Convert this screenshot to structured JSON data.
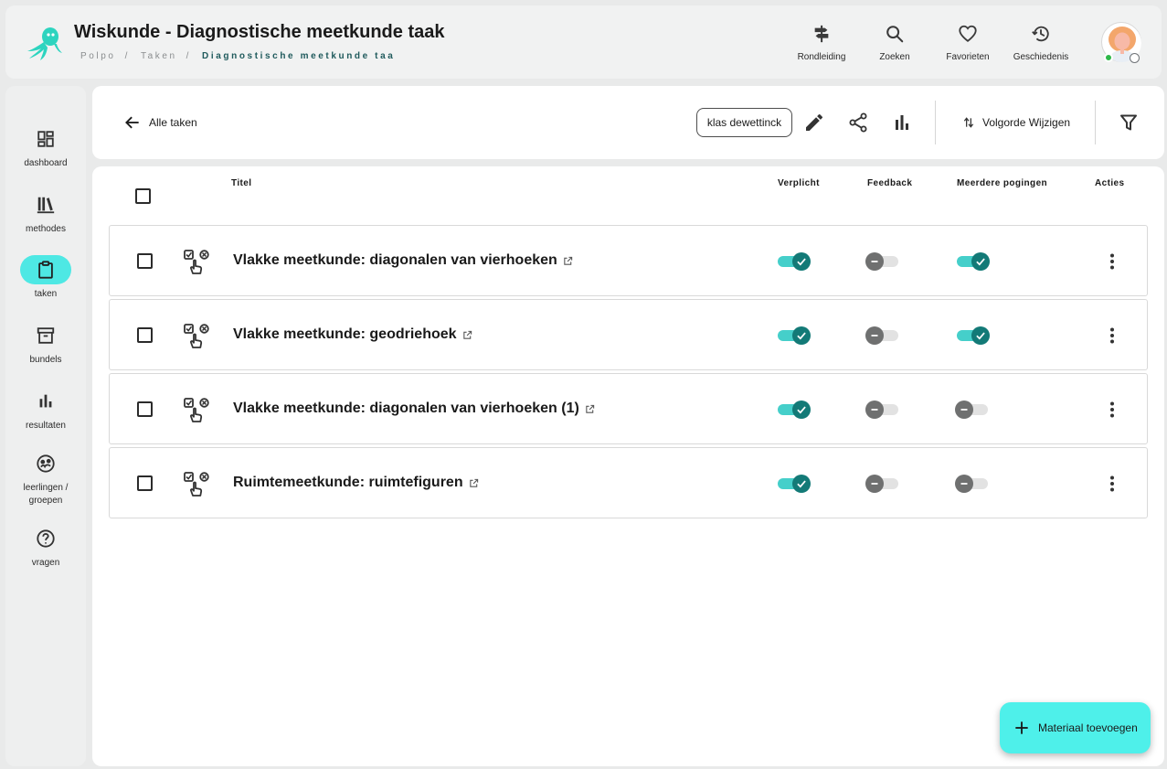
{
  "app": {
    "title": "Wiskunde - Diagnostische meetkunde taak",
    "brand_color": "#2dd4bf",
    "accent_color": "#4ef0ea"
  },
  "breadcrumb": {
    "items": [
      "Polpo",
      "Taken"
    ],
    "current": "Diagnostische meetkunde taa"
  },
  "header_nav": [
    {
      "label": "Rondleiding",
      "icon": "signpost-icon"
    },
    {
      "label": "Zoeken",
      "icon": "search-icon"
    },
    {
      "label": "Favorieten",
      "icon": "heart-icon"
    },
    {
      "label": "Geschiedenis",
      "icon": "history-icon"
    }
  ],
  "sidebar": {
    "items": [
      {
        "label": "dashboard",
        "icon": "dashboard-icon",
        "active": false
      },
      {
        "label": "methodes",
        "icon": "library-icon",
        "active": false
      },
      {
        "label": "taken",
        "icon": "clipboard-icon",
        "active": true
      },
      {
        "label": "bundels",
        "icon": "archive-icon",
        "active": false
      },
      {
        "label": "resultaten",
        "icon": "bar-chart-icon",
        "active": false
      },
      {
        "label": "leerlingen / groepen",
        "icon": "group-icon",
        "active": false
      },
      {
        "label": "vragen",
        "icon": "help-icon",
        "active": false
      }
    ]
  },
  "toolbar": {
    "back_label": "Alle taken",
    "class_chip": "klas dewettinck",
    "order_label": "Volgorde Wijzigen"
  },
  "table": {
    "headers": {
      "title": "Titel",
      "required": "Verplicht",
      "feedback": "Feedback",
      "multiple_attempts": "Meerdere pogingen",
      "actions": "Acties"
    },
    "rows": [
      {
        "title": "Vlakke meetkunde: diagonalen van vierhoeken",
        "verplicht": true,
        "feedback": false,
        "meerdere_pogingen": true
      },
      {
        "title": "Vlakke meetkunde: geodriehoek",
        "verplicht": true,
        "feedback": false,
        "meerdere_pogingen": true
      },
      {
        "title": "Vlakke meetkunde: diagonalen van vierhoeken (1)",
        "verplicht": true,
        "feedback": false,
        "meerdere_pogingen": false
      },
      {
        "title": "Ruimtemeetkunde: ruimtefiguren",
        "verplicht": true,
        "feedback": false,
        "meerdere_pogingen": false
      }
    ]
  },
  "fab": {
    "label": "Materiaal toevoegen"
  }
}
